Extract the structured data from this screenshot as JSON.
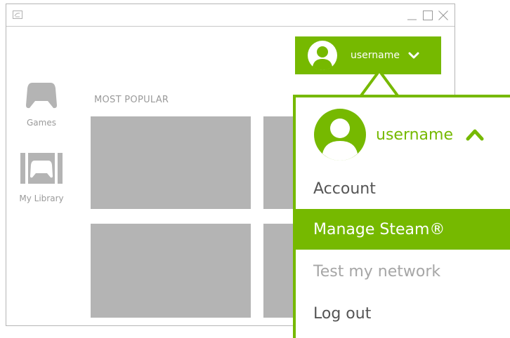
{
  "window": {
    "controls": [
      "minimize-icon",
      "maximize-icon",
      "close-icon"
    ]
  },
  "sidebar": {
    "items": [
      {
        "label": "Games",
        "icon": "gamepad-icon"
      },
      {
        "label": "My Library",
        "icon": "library-gamepad-icon"
      }
    ]
  },
  "main": {
    "section_title": "MOST POPULAR"
  },
  "user_button": {
    "username": "username",
    "icon": "chevron-down-icon"
  },
  "dropdown": {
    "username": "username",
    "icon": "chevron-up-icon",
    "items": [
      {
        "label": "Account",
        "state": "normal"
      },
      {
        "label": "Manage Steam®",
        "state": "active"
      },
      {
        "label": "Test my network",
        "state": "disabled"
      },
      {
        "label": "Log out",
        "state": "normal"
      }
    ]
  },
  "colors": {
    "accent": "#76b900",
    "tile": "#b4b4b4",
    "text_muted": "#9a9a9a",
    "text": "#555555"
  }
}
